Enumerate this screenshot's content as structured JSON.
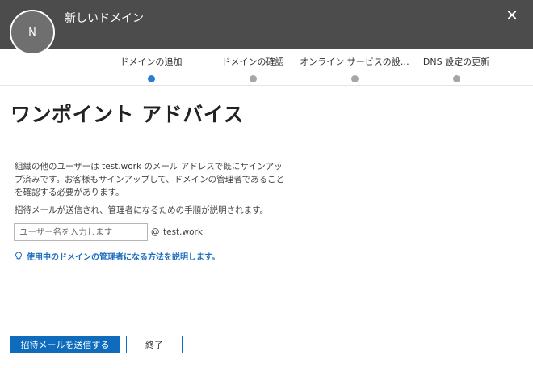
{
  "header": {
    "avatar_initial": "N",
    "title": "新しいドメイン",
    "close_glyph": "✕",
    "background": "#4c4c4c"
  },
  "steps": [
    {
      "label": "ドメインの追加",
      "state": "active"
    },
    {
      "label": "ドメインの確認",
      "state": "pending"
    },
    {
      "label": "オンライン サービスの設…",
      "state": "pending"
    },
    {
      "label": "DNS 設定の更新",
      "state": "pending"
    }
  ],
  "main": {
    "heading": "ワンポイント アドバイス",
    "desc_before": "組織の他のユーザーは",
    "desc_domain": "test.work",
    "desc_after": "のメール アドレスで既にサインアップ済みです。お客様もサインアップして、ドメインの管理者であることを確認する必要があります。",
    "note": "招待メールが送信され、管理者になるための手順が説明されます。",
    "username_input": {
      "value": "",
      "placeholder": "ユーザー名を入力します"
    },
    "at_sign": "@",
    "domain_suffix": "test.work",
    "help_link": "使用中のドメインの管理者になる方法を説明します。",
    "help_icon": "lightbulb-icon"
  },
  "footer": {
    "send_button": "招待メールを送信する",
    "finish_button": "終了"
  },
  "colors": {
    "accent": "#0f6cbd",
    "active_step": "#2b7cd3",
    "link": "#1f6fbf"
  }
}
